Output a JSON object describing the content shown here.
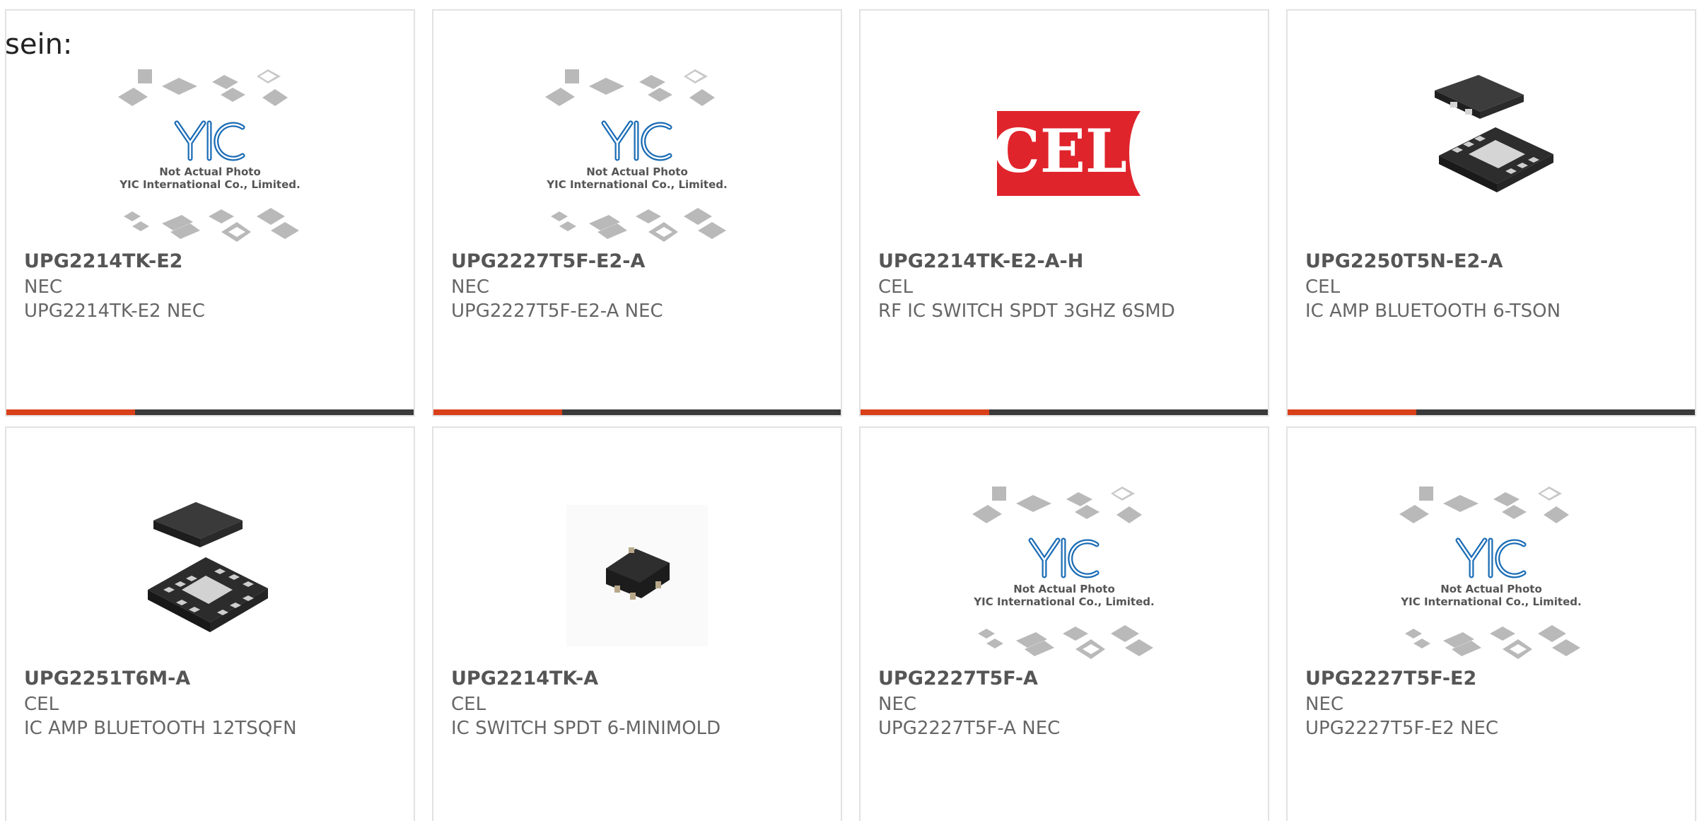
{
  "lead_text": "sein:",
  "colors": {
    "accent": "#d9401a",
    "bar": "#3a3a3a",
    "cel_red": "#e0242c"
  },
  "placeholder": {
    "logo": "YIC",
    "line1": "Not Actual Photo",
    "line2": "YIC International Co., Limited."
  },
  "cel_logo_text": "CEL",
  "products": [
    {
      "part": "UPG2214TK-E2",
      "maker": "NEC",
      "desc": "UPG2214TK-E2 NEC",
      "image": "placeholder-image"
    },
    {
      "part": "UPG2227T5F-E2-A",
      "maker": "NEC",
      "desc": "UPG2227T5F-E2-A NEC",
      "image": "placeholder-image"
    },
    {
      "part": "UPG2214TK-E2-A-H",
      "maker": "CEL",
      "desc": "RF IC SWITCH SPDT 3GHZ 6SMD",
      "image": "cel-logo"
    },
    {
      "part": "UPG2250T5N-E2-A",
      "maker": "CEL",
      "desc": "IC AMP BLUETOOTH 6-TSON",
      "image": "tson-chip"
    },
    {
      "part": "UPG2251T6M-A",
      "maker": "CEL",
      "desc": "IC AMP BLUETOOTH 12TSQFN",
      "image": "qfn-chip"
    },
    {
      "part": "UPG2214TK-A",
      "maker": "CEL",
      "desc": "IC SWITCH SPDT 6-MINIMOLD",
      "image": "minimold-chip"
    },
    {
      "part": "UPG2227T5F-A",
      "maker": "NEC",
      "desc": "UPG2227T5F-A NEC",
      "image": "placeholder-image"
    },
    {
      "part": "UPG2227T5F-E2",
      "maker": "NEC",
      "desc": "UPG2227T5F-E2 NEC",
      "image": "placeholder-image"
    }
  ]
}
